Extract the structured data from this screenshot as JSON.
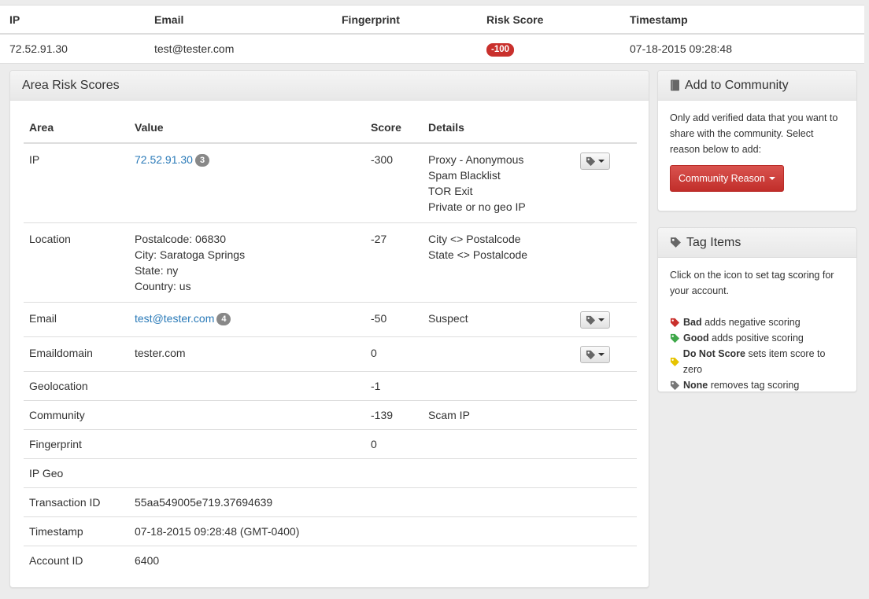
{
  "top_table": {
    "headers": [
      "IP",
      "Email",
      "Fingerprint",
      "Risk Score",
      "Timestamp"
    ],
    "row": {
      "ip": "72.52.91.30",
      "email": "test@tester.com",
      "fingerprint": "",
      "risk_score": "-100",
      "timestamp": "07-18-2015 09:28:48"
    }
  },
  "area_panel": {
    "title": "Area Risk Scores",
    "headers": [
      "Area",
      "Value",
      "Score",
      "Details"
    ],
    "rows": [
      {
        "area": "IP",
        "value": "72.52.91.30",
        "count": "3",
        "score": "-300",
        "details": [
          "Proxy - Anonymous",
          "Spam Blacklist",
          "TOR Exit",
          "Private or no geo IP"
        ]
      },
      {
        "area": "Location",
        "value_lines": [
          "Postalcode: 06830",
          "City: Saratoga Springs",
          "State: ny",
          "Country: us"
        ],
        "score": "-27",
        "details": [
          "City <> Postalcode",
          "State <> Postalcode"
        ]
      },
      {
        "area": "Email",
        "value": "test@tester.com",
        "count": "4",
        "score": "-50",
        "details": [
          "Suspect"
        ]
      },
      {
        "area": "Emaildomain",
        "value": "tester.com",
        "score": "0"
      },
      {
        "area": "Geolocation",
        "score": "-1"
      },
      {
        "area": "Community",
        "score": "-139",
        "details": [
          "Scam IP"
        ]
      },
      {
        "area": "Fingerprint",
        "score": "0"
      },
      {
        "area": "IP Geo"
      },
      {
        "area": "Transaction ID",
        "value": "55aa549005e719.37694639"
      },
      {
        "area": "Timestamp",
        "value": "07-18-2015 09:28:48 (GMT-0400)"
      },
      {
        "area": "Account ID",
        "value": "6400"
      }
    ]
  },
  "community_panel": {
    "title": "Add to Community",
    "description": "Only add verified data that you want to share with the community. Select reason below to add:",
    "button_label": "Community Reason"
  },
  "tag_panel": {
    "title": "Tag Items",
    "description": "Click on the icon to set tag scoring for your account.",
    "legend": [
      {
        "name": "Bad",
        "text": "adds negative scoring",
        "color": "#c9302c"
      },
      {
        "name": "Good",
        "text": "adds positive scoring",
        "color": "#3fa84a"
      },
      {
        "name": "Do Not Score",
        "text": "sets item score to zero",
        "color": "#e6c300"
      },
      {
        "name": "None",
        "text": "removes tag scoring",
        "color": "#777777"
      }
    ]
  },
  "icons": {
    "tag": "tag-icon",
    "book": "book-icon",
    "caret": "caret-down-icon"
  }
}
